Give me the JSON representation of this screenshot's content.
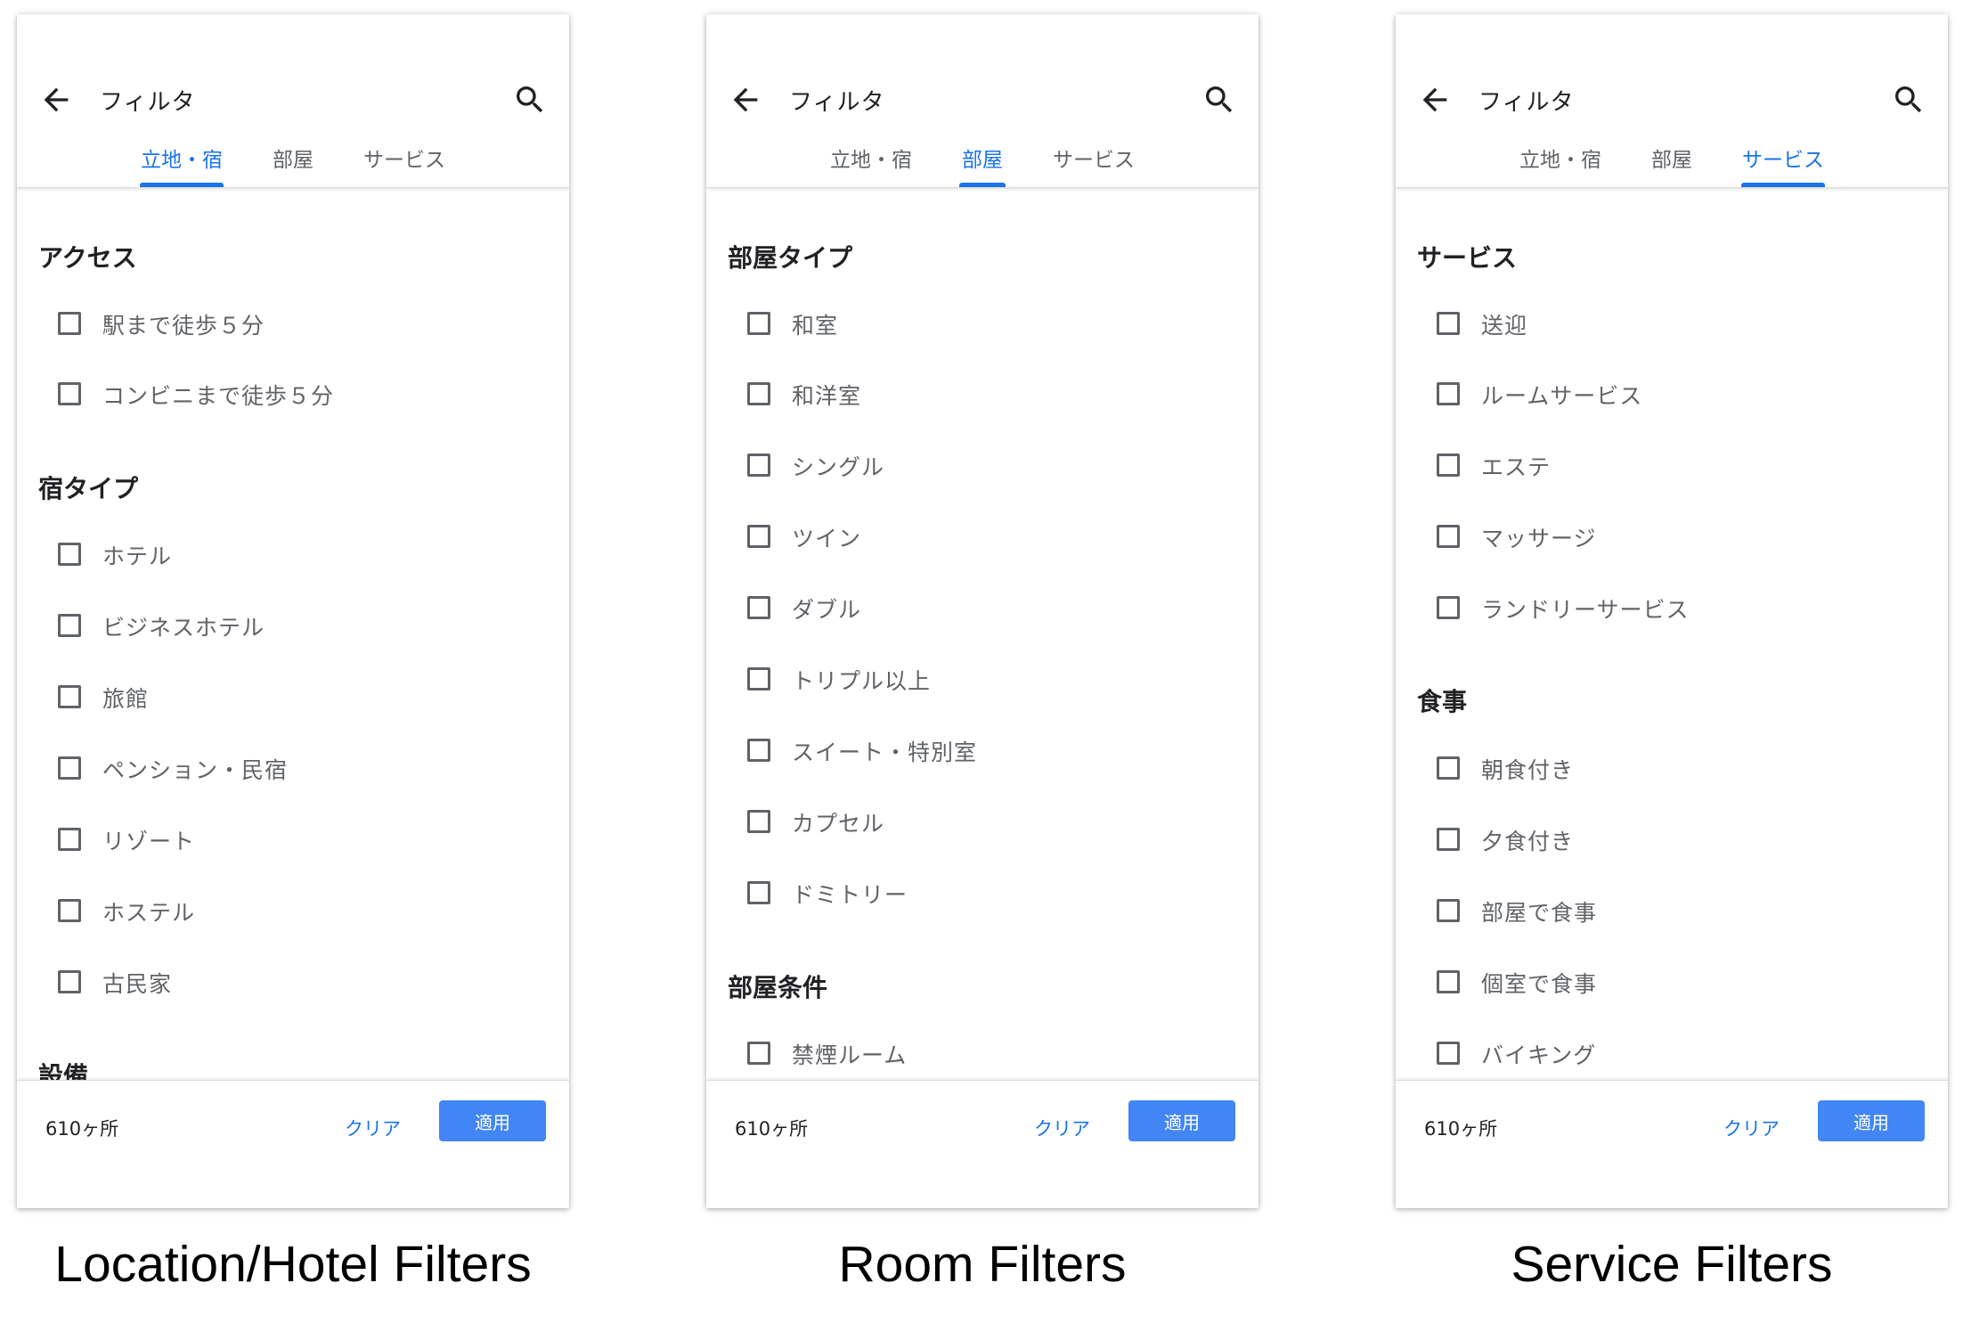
{
  "common": {
    "title": "フィルタ",
    "tabs": [
      "立地・宿",
      "部屋",
      "サービス"
    ],
    "count": "610ヶ所",
    "clear_label": "クリア",
    "apply_label": "適用",
    "accent_color": "#1a73e8",
    "apply_color": "#4285f4",
    "icons": [
      "arrow-back-icon",
      "search-icon",
      "checkbox-icon"
    ]
  },
  "screens": [
    {
      "caption": "Location/Hotel Filters",
      "active_tab": 0,
      "sections": [
        {
          "title": "アクセス",
          "items": [
            "駅まで徒歩５分",
            "コンビニまで徒歩５分"
          ]
        },
        {
          "title": "宿タイプ",
          "items": [
            "ホテル",
            "ビジネスホテル",
            "旅館",
            "ペンション・民宿",
            "リゾート",
            "ホステル",
            "古民家"
          ]
        },
        {
          "title": "設備",
          "items": []
        }
      ]
    },
    {
      "caption": "Room Filters",
      "active_tab": 1,
      "sections": [
        {
          "title": "部屋タイプ",
          "items": [
            "和室",
            "和洋室",
            "シングル",
            "ツイン",
            "ダブル",
            "トリプル以上",
            "スイート・特別室",
            "カプセル",
            "ドミトリー"
          ]
        },
        {
          "title": "部屋条件",
          "items": [
            "禁煙ルーム"
          ]
        }
      ]
    },
    {
      "caption": "Service Filters",
      "active_tab": 2,
      "sections": [
        {
          "title": "サービス",
          "items": [
            "送迎",
            "ルームサービス",
            "エステ",
            "マッサージ",
            "ランドリーサービス"
          ]
        },
        {
          "title": "食事",
          "items": [
            "朝食付き",
            "夕食付き",
            "部屋で食事",
            "個室で食事",
            "バイキング"
          ]
        }
      ]
    }
  ]
}
